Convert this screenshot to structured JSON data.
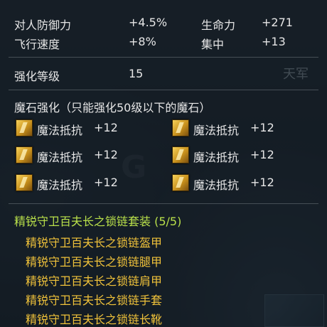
{
  "stats": {
    "row1": {
      "label_a": "对人防御力",
      "value_a": "+4.5%",
      "label_b": "生命力",
      "value_b": "+271"
    },
    "row2": {
      "label_a": "飞行速度",
      "value_a": "+8%",
      "label_b": "集中",
      "value_b": "+13"
    }
  },
  "enhance": {
    "label": "强化等级",
    "value": "15"
  },
  "watermark_text": "天军",
  "magic_stone": {
    "header": "魔石强化（只能强化50级以下的魔石）",
    "items": [
      {
        "name": "魔法抵抗",
        "value": "+12"
      },
      {
        "name": "魔法抵抗",
        "value": "+12"
      },
      {
        "name": "魔法抵抗",
        "value": "+12"
      },
      {
        "name": "魔法抵抗",
        "value": "+12"
      },
      {
        "name": "魔法抵抗",
        "value": "+12"
      },
      {
        "name": "魔法抵抗",
        "value": "+12"
      }
    ],
    "icon": "gold-gem-icon"
  },
  "set": {
    "title": "精锐守卫百夫长之锁链套装 (5/5)",
    "pieces": [
      "精锐守卫百夫长之锁链盔甲",
      "精锐守卫百夫长之锁链腿甲",
      "精锐守卫百夫长之锁链肩甲",
      "精锐守卫百夫长之锁链手套",
      "精锐守卫百夫长之锁链长靴"
    ]
  },
  "colors": {
    "set_title": "#b9e04a",
    "set_piece": "#f0c23a",
    "text": "#e6e6e6"
  }
}
